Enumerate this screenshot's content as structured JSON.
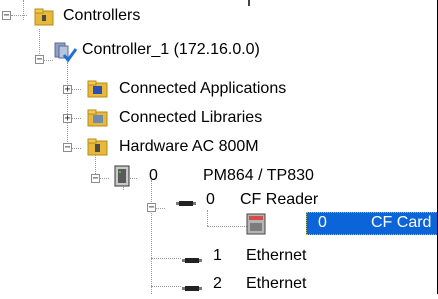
{
  "tree": {
    "nodes": [
      {
        "id": "controllers",
        "label": "Controllers",
        "icon": "controllers-folder-icon",
        "expanded": true
      },
      {
        "id": "controller1",
        "label": "Controller_1 (172.16.0.0)",
        "icon": "controller-check-icon",
        "expanded": true
      },
      {
        "id": "connected_apps",
        "label": "Connected Applications",
        "icon": "applications-folder-icon",
        "expanded": false
      },
      {
        "id": "connected_libs",
        "label": "Connected Libraries",
        "icon": "libraries-folder-icon",
        "expanded": false
      },
      {
        "id": "hardware",
        "label": "Hardware  AC 800M",
        "icon": "hardware-folder-icon",
        "expanded": true
      },
      {
        "id": "pm864",
        "position": "0",
        "label": "PM864 / TP830",
        "icon": "cpu-module-icon",
        "expanded": true
      },
      {
        "id": "cfreader",
        "position": "0",
        "label": "CF Reader",
        "icon": "port-icon",
        "expanded": true
      },
      {
        "id": "cfcard",
        "position": "0",
        "label": "CF Card",
        "icon": "cf-card-icon",
        "selected": true
      },
      {
        "id": "ethernet1",
        "position": "1",
        "label": "Ethernet",
        "icon": "port-icon"
      },
      {
        "id": "ethernet2",
        "position": "2",
        "label": "Ethernet",
        "icon": "port-icon"
      }
    ]
  },
  "colors": {
    "selection": "#0b64d8",
    "selection_border": "#f2b100",
    "tree_lines": "#9a9a9a"
  }
}
